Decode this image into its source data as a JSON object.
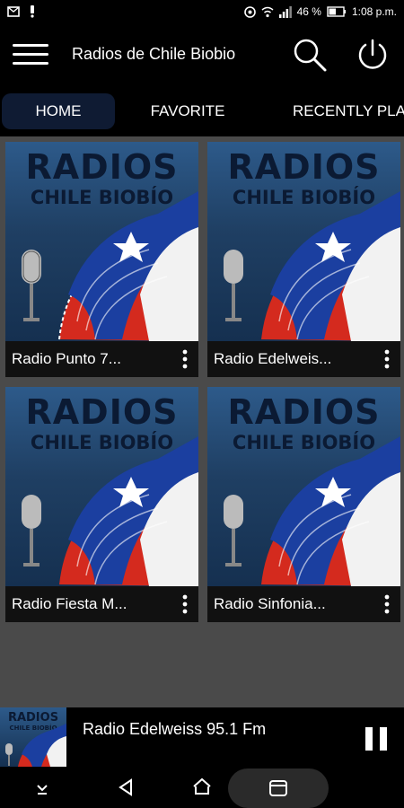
{
  "status_bar": {
    "battery_text": "46 %",
    "time": "1:08 p.m."
  },
  "app_bar": {
    "title": "Radios de Chile Biobio",
    "menu_icon": "hamburger-menu-icon",
    "search_icon": "search-icon",
    "power_icon": "power-icon"
  },
  "tabs": [
    {
      "label": "HOME",
      "active": true
    },
    {
      "label": "FAVORITE",
      "active": false
    },
    {
      "label": "RECENTLY PLA",
      "active": false
    }
  ],
  "artwork": {
    "line1": "RADIOS",
    "line2": "CHILE BIOBÍO"
  },
  "stations": [
    {
      "label": "Radio Punto 7..."
    },
    {
      "label": "Radio Edelweis..."
    },
    {
      "label": "Radio Fiesta M..."
    },
    {
      "label": "Radio Sinfonia..."
    }
  ],
  "player": {
    "now_playing": "Radio Edelweiss 95.1 Fm",
    "thumb_line1": "RADIOS",
    "thumb_line2": "CHILE BIOBÍO"
  },
  "colors": {
    "accent_tab": "#0f1b33",
    "background": "#4a4a4a",
    "flag_red": "#d42a1e",
    "flag_blue": "#1b3fa0"
  }
}
